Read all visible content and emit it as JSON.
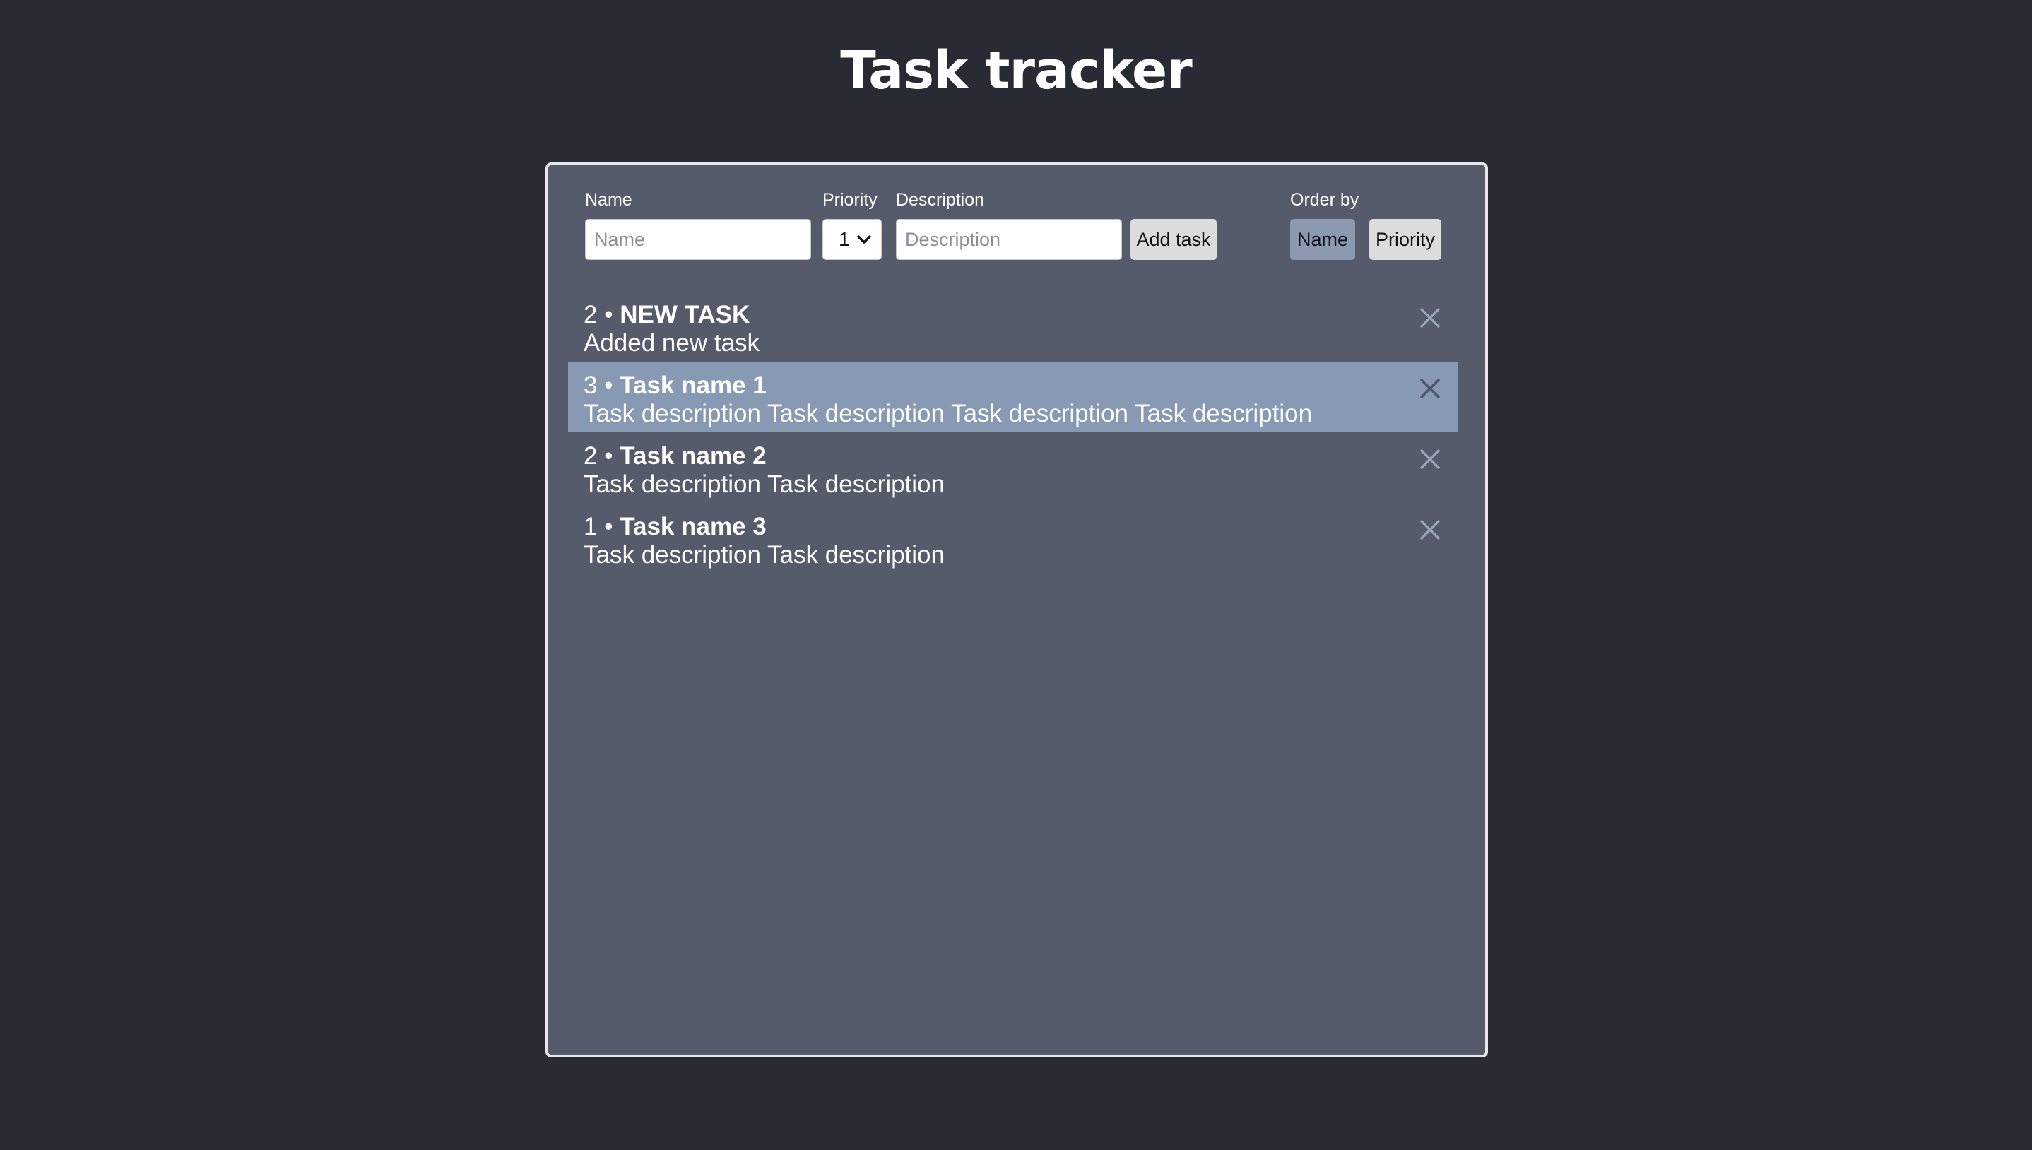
{
  "page": {
    "title": "Task tracker"
  },
  "form": {
    "name_label": "Name",
    "name_placeholder": "Name",
    "name_value": "",
    "priority_label": "Priority",
    "priority_value": "1",
    "description_label": "Description",
    "description_placeholder": "Description",
    "description_value": "",
    "add_button_label": "Add task"
  },
  "order": {
    "label": "Order by",
    "options": [
      {
        "label": "Name",
        "active": true
      },
      {
        "label": "Priority",
        "active": false
      }
    ]
  },
  "tasks": [
    {
      "priority": "2",
      "separator": "•",
      "name": "NEW TASK",
      "description": "Added new task",
      "selected": false
    },
    {
      "priority": "3",
      "separator": "•",
      "name": "Task name 1",
      "description": "Task description Task description Task description Task description",
      "selected": true
    },
    {
      "priority": "2",
      "separator": "•",
      "name": "Task name 2",
      "description": "Task description Task description",
      "selected": false
    },
    {
      "priority": "1",
      "separator": "•",
      "name": "Task name 3",
      "description": "Task description Task description",
      "selected": false
    }
  ],
  "colors": {
    "background": "#282b33",
    "panel": "#555b6b",
    "selected_row": "#8899b3",
    "active_sort_button": "#8b99b1",
    "close_icon": "#9aa5b8",
    "close_icon_selected": "#4f5566"
  },
  "icons": {
    "delete": "close-icon",
    "dropdown": "chevron-down-icon"
  }
}
